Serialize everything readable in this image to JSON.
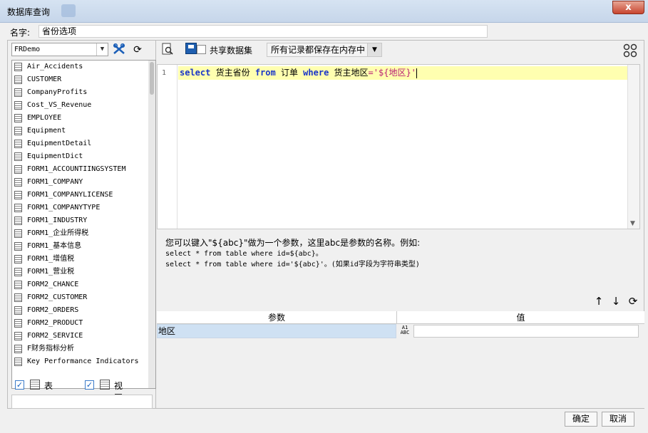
{
  "window": {
    "title": "数据库查询",
    "close_label": "x"
  },
  "name_field": {
    "label": "名字:",
    "value": "省份选项"
  },
  "left_panel": {
    "connection": "FRDemo",
    "tables": [
      "Air_Accidents",
      "CUSTOMER",
      "CompanyProfits",
      "Cost_VS_Revenue",
      "EMPLOYEE",
      "Equipment",
      "EquipmentDetail",
      "EquipmentDict",
      "FORM1_ACCOUNTIINGSYSTEM",
      "FORM1_COMPANY",
      "FORM1_COMPANYLICENSE",
      "FORM1_COMPANYTYPE",
      "FORM1_INDUSTRY",
      "FORM1_企业所得税",
      "FORM1_基本信息",
      "FORM1_增值税",
      "FORM1_营业税",
      "FORM2_CHANCE",
      "FORM2_CUSTOMER",
      "FORM2_ORDERS",
      "FORM2_PRODUCT",
      "FORM2_SERVICE",
      "F财务指标分析",
      "Key Performance Indicators"
    ],
    "filter_table_label": "表",
    "filter_view_label": "视图",
    "filter_table_checked": true,
    "filter_view_checked": true
  },
  "right_panel": {
    "share_label": "共享数据集",
    "share_checked": false,
    "storage_mode": "所有记录都保存在内存中",
    "editor": {
      "line_number": "1",
      "sql": {
        "kw_select": "select",
        "t1": " 货主省份 ",
        "kw_from": "from",
        "t2": " 订单 ",
        "kw_where": "where",
        "t3": " 货主地区",
        "op": "=",
        "str": "'${地区}'"
      }
    },
    "hint": {
      "line1": "您可以键入\"${abc}\"做为一个参数，这里abc是参数的名称。例如:",
      "line2": "select * from table where id=${abc}。",
      "line3": "select * from table where id='${abc}'。(如果id字段为字符串类型)"
    },
    "param_table": {
      "col_param": "参数",
      "col_value": "值",
      "rows": [
        {
          "name": "地区",
          "type_glyph": "A1 ABC",
          "value": ""
        }
      ]
    }
  },
  "buttons": {
    "ok": "确定",
    "cancel": "取消"
  }
}
